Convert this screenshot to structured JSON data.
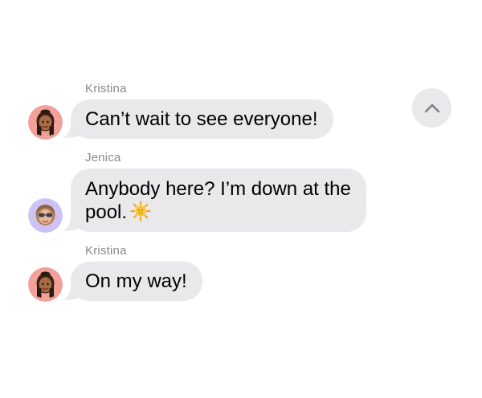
{
  "colors": {
    "bubble_background": "#e9e9eb",
    "sender_name": "#8a8a8e",
    "scroll_button_background": "#e9e9eb",
    "chevron": "#7f7f85"
  },
  "scroll_button": {
    "icon": "chevron-up-icon"
  },
  "messages": [
    {
      "sender": "Kristina",
      "avatar": "memoji-kristina",
      "text": "Can’t wait to see everyone!"
    },
    {
      "sender": "Jenica",
      "avatar": "memoji-jenica",
      "text_line1": "Anybody here? I’m down at the",
      "text_line2": "pool.",
      "emoji": "sun-emoji"
    },
    {
      "sender": "Kristina",
      "avatar": "memoji-kristina",
      "text": "On my way!"
    }
  ]
}
